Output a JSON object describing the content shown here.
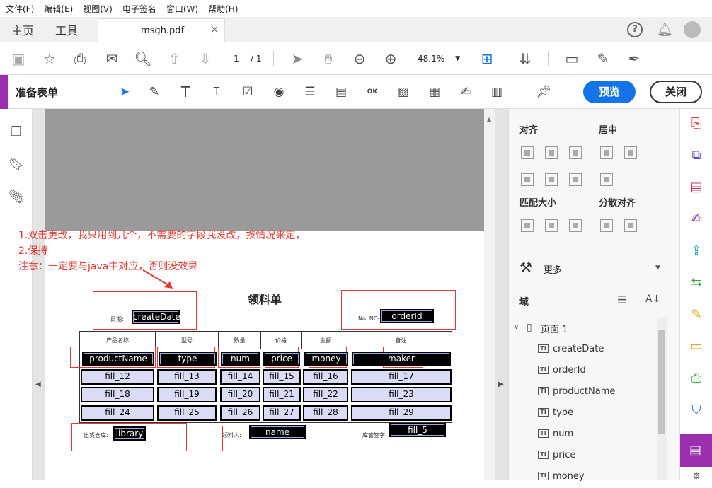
{
  "menu": [
    "文件(F)",
    "编辑(E)",
    "视图(V)",
    "电子签名",
    "窗口(W)",
    "帮助(H)"
  ],
  "tabs": {
    "home": "主页",
    "tools": "工具",
    "doc": "msgh.pdf",
    "close": "×"
  },
  "toolbar": {
    "page_current": "1",
    "page_total": "/ 1",
    "zoom": "48.1%"
  },
  "prepare": {
    "title": "准备表单",
    "preview": "预览",
    "close": "关闭"
  },
  "notes": [
    "1.双击更改，我只用到几个，不需要的字段我没改，按情况来定，",
    "2.保持",
    "注意：一定要与java中对应，否则没效果"
  ],
  "form": {
    "title": "领料单",
    "date_label": "日期:",
    "order_label": "No. NC-",
    "headers": [
      "产品名称",
      "型号",
      "数量",
      "价格",
      "金额",
      "备注"
    ],
    "row1": [
      "productName",
      "type",
      "num",
      "price",
      "money",
      "maker"
    ],
    "rows": [
      [
        "fill_12",
        "fill_13",
        "fill_14",
        "fill_15",
        "fill_16",
        "fill_17"
      ],
      [
        "fill_18",
        "fill_19",
        "fill_20",
        "fill_21",
        "fill_22",
        "fill_23"
      ],
      [
        "fill_24",
        "fill_25",
        "fill_26",
        "fill_27",
        "fill_28",
        "fill_29"
      ]
    ],
    "create_date": "createDate",
    "order_id": "orderId",
    "warehouse_label": "出货仓库:",
    "library": "library",
    "receiver_label": "领料人:",
    "name": "name",
    "keeper_label": "库管签字:",
    "fill5": "fill_5"
  },
  "panel": {
    "align": "对齐",
    "center": "居中",
    "match": "匹配大小",
    "distribute": "分散对齐",
    "more": "更多",
    "fields": "域",
    "page": "页面 1",
    "field_list": [
      "createDate",
      "orderId",
      "productName",
      "type",
      "num",
      "price",
      "money"
    ]
  },
  "colors": {
    "accent": "#9b2fae",
    "preview": "#1473e6",
    "note": "#e53935"
  }
}
